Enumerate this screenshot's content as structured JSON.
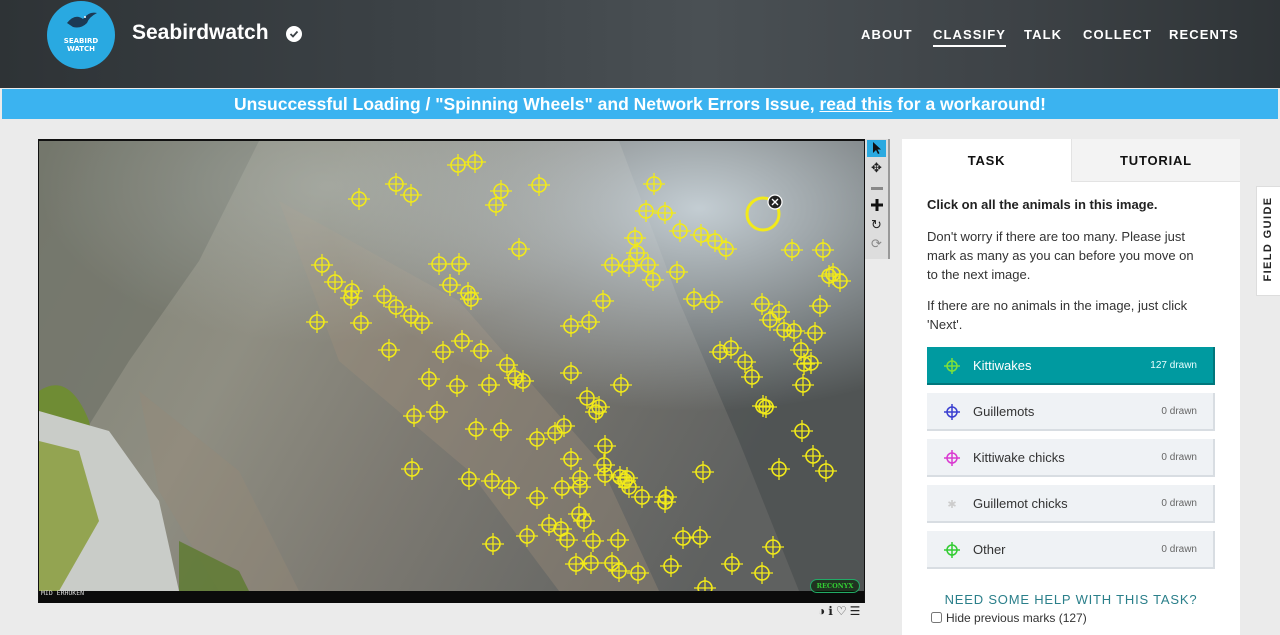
{
  "header": {
    "logo_text": [
      "SEABIRD",
      "WATCH"
    ],
    "title": "Seabirdwatch",
    "nav": [
      {
        "label": "ABOUT",
        "active": false
      },
      {
        "label": "CLASSIFY",
        "active": true
      },
      {
        "label": "TALK",
        "active": false
      },
      {
        "label": "COLLECT",
        "active": false
      },
      {
        "label": "RECENTS",
        "active": false
      }
    ]
  },
  "banner": {
    "text_before": "Unsuccessful Loading / \"Spinning Wheels\" and Network Errors Issue, ",
    "link_text": "read this",
    "text_after": " for a workaround!"
  },
  "image": {
    "camera_label": "MID ERHUKEN",
    "brand": "RECONYX",
    "mark_color": "#f2ea1a"
  },
  "toolbar": {
    "tools": [
      "pointer-icon",
      "move-icon",
      "zoom-out-icon",
      "zoom-in-icon",
      "rotate-icon",
      "reset-icon"
    ]
  },
  "image_actions": [
    "contrast-icon",
    "info-icon",
    "favorite-icon",
    "collections-icon"
  ],
  "panel": {
    "tabs": [
      "TASK",
      "TUTORIAL"
    ],
    "question": "Click on all the animals in this image.",
    "help_1": "Don't worry if there are too many. Please just mark as many as you can before you move on to the next image.",
    "help_2": "If there are no animals in the image, just click 'Next'.",
    "choices": [
      {
        "label": "Kittiwakes",
        "count": "127 drawn",
        "color": "#7ee03a",
        "active": true
      },
      {
        "label": "Guillemots",
        "count": "0 drawn",
        "color": "#3a3fd0",
        "active": false
      },
      {
        "label": "Kittiwake chicks",
        "count": "0 drawn",
        "color": "#d93ad0",
        "active": false
      },
      {
        "label": "Guillemot chicks",
        "count": "0 drawn",
        "color": "#dddddd",
        "active": false
      },
      {
        "label": "Other",
        "count": "0 drawn",
        "color": "#33cc33",
        "active": false
      }
    ],
    "need_help": "NEED SOME HELP WITH THIS TASK?",
    "hide_marks": "Hide previous marks (127)"
  },
  "field_guide": "FIELD GUIDE"
}
